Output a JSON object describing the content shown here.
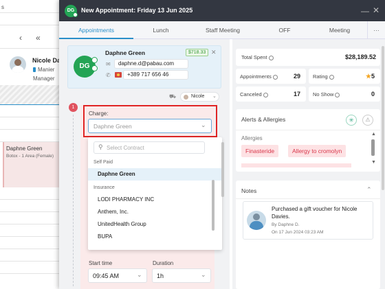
{
  "background": {
    "view_label": "s",
    "staff_name": "Nicole Da",
    "staff_sub": "Manier",
    "staff_role": "Manager",
    "appointment_client": "Daphne Green",
    "appointment_service": "Botox - 1 Area (Female)"
  },
  "modal": {
    "avatar_initials": "DG",
    "title": "New Appointment: Friday 13 Jun 2025"
  },
  "tabs": [
    "Appointments",
    "Lunch",
    "Staff Meeting",
    "OFF",
    "Meeting"
  ],
  "tabs_more": "···",
  "client": {
    "initials": "DG",
    "name": "Daphne Green",
    "balance": "$718.33",
    "email": "daphne.d@pabau.com",
    "phone": "+389 717 656 46"
  },
  "assignee": "Nicole",
  "step_number": "1",
  "charge": {
    "label": "Charge:",
    "placeholder": "Daphne Green",
    "search_placeholder": "Select Contract",
    "groups": [
      {
        "title": "Self Paid",
        "options": [
          "Daphne Green"
        ]
      },
      {
        "title": "Insurance",
        "options": [
          "LODI PHARMACY INC",
          "Anthem, Inc.",
          "UnitedHealth Group",
          "BUPA"
        ]
      }
    ],
    "selected": "Daphne Green"
  },
  "start_time": {
    "label": "Start time",
    "value": "09:45 AM"
  },
  "duration": {
    "label": "Duration",
    "value": "1h"
  },
  "stats": {
    "total_spent_label": "Total Spent",
    "total_spent": "$28,189.52",
    "appointments_label": "Appointments",
    "appointments": "29",
    "rating_label": "Rating",
    "rating": "5",
    "canceled_label": "Canceled",
    "canceled": "17",
    "no_show_label": "No Show",
    "no_show": "0"
  },
  "alerts": {
    "title": "Alerts & Allergies",
    "section": "Allergies",
    "tags": [
      "Finasteride",
      "Allergy to cromolyn"
    ]
  },
  "notes": {
    "title": "Notes",
    "text": "Purchased a gift voucher for Nicole Davies.",
    "author": "By Daphne D.",
    "date": "On 17 Jun 2024 03:23 AM"
  },
  "colors": {
    "titlebar": "#333741",
    "accent": "#2a8fc9",
    "avatar": "#23a455",
    "highlight_border": "#e02424",
    "tag_bg": "#fde2e4",
    "tag_text": "#d9364a",
    "balance": "#3a9a3a"
  }
}
